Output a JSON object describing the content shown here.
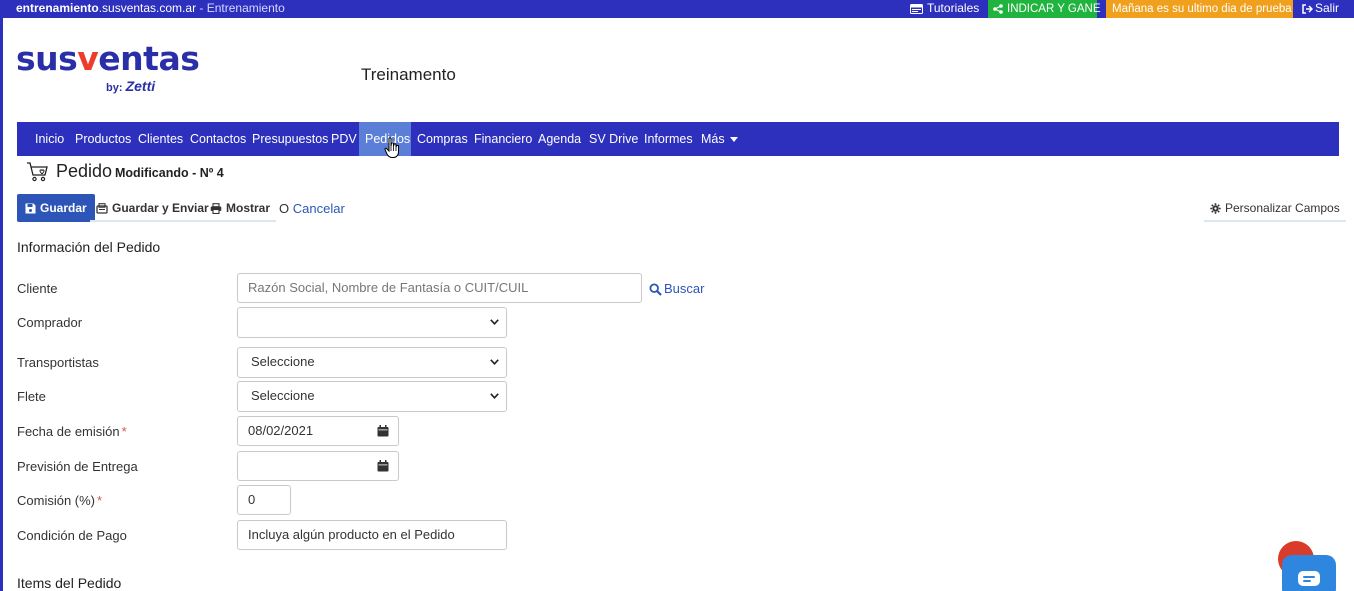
{
  "topbar": {
    "domain_bold": "entrenamiento",
    "domain_rest": ".susventas.com.ar",
    "env": " - Entrenamiento",
    "tutorials": "Tutoriales",
    "indicar": "INDICAR Y GANE",
    "trial": "Mañana es su ultimo dia de prueba",
    "logout": "Salir"
  },
  "logo": {
    "brand_pre": "sus",
    "brand_v": "v",
    "brand_post": "entas",
    "by": "by:",
    "zetti": "Zetti"
  },
  "company": "Treinamento",
  "nav": {
    "items": [
      "Inicio",
      "Productos",
      "Clientes",
      "Contactos",
      "Presupuestos",
      "PDV",
      "Pedidos",
      "Compras",
      "Financiero",
      "Agenda",
      "SV Drive",
      "Informes",
      "Más"
    ],
    "active": "Pedidos"
  },
  "page": {
    "title": "Pedido",
    "subtitle": "Modificando - Nº 4"
  },
  "toolbar": {
    "save": "Guardar",
    "save_send": "Guardar y Enviar",
    "show": "Mostrar",
    "cancel_prefix": "O",
    "cancel": "Cancelar",
    "customize": "Personalizar Campos"
  },
  "section_info": "Información del Pedido",
  "section_items": "Items del Pedido",
  "form": {
    "cliente": {
      "label": "Cliente",
      "placeholder": "Razón Social, Nombre de Fantasía o CUIT/CUIL",
      "search": "Buscar"
    },
    "comprador": {
      "label": "Comprador",
      "value": ""
    },
    "transportistas": {
      "label": "Transportistas",
      "value": "Seleccione"
    },
    "flete": {
      "label": "Flete",
      "value": "Seleccione"
    },
    "fecha": {
      "label": "Fecha de emisión",
      "value": "08/02/2021",
      "required": "*"
    },
    "prevision": {
      "label": "Previsión de Entrega",
      "value": ""
    },
    "comision": {
      "label": "Comisión (%)",
      "value": "0",
      "required": "*"
    },
    "condicion": {
      "label": "Condición de Pago",
      "value": "Incluya algún producto en el Pedido"
    }
  },
  "colors": {
    "brand_blue": "#2d2fbd",
    "active_tab": "#5b7fd6",
    "green": "#1fb43d",
    "orange": "#f0a01c",
    "primary": "#2d55b8"
  }
}
